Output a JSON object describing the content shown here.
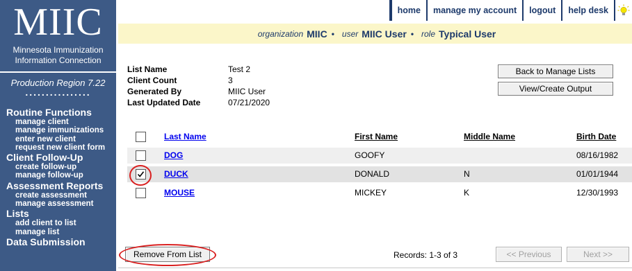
{
  "sidebar": {
    "logo": "MIIC",
    "subtitle_line1": "Minnesota Immunization",
    "subtitle_line2": "Information Connection",
    "region": "Production Region 7.22",
    "dots": "................",
    "sections": [
      {
        "heading": "Routine Functions",
        "items": [
          "manage client",
          "manage immunizations",
          "enter new client",
          "request new client form"
        ]
      },
      {
        "heading": "Client Follow-Up",
        "items": [
          "create follow-up",
          "manage follow-up"
        ]
      },
      {
        "heading": "Assessment Reports",
        "items": [
          "create assessment",
          "manage assessment"
        ]
      },
      {
        "heading": "Lists",
        "items": [
          "add client to list",
          "manage list"
        ]
      },
      {
        "heading": "Data Submission",
        "items": []
      }
    ]
  },
  "topnav": {
    "home": "home",
    "manage_account": "manage my account",
    "logout": "logout",
    "help_desk": "help desk",
    "bulb_icon": "lightbulb-icon"
  },
  "info_bar": {
    "org_label": "organization",
    "org_value": "MIIC",
    "user_label": "user",
    "user_value": "MIIC User",
    "role_label": "role",
    "role_value": "Typical User"
  },
  "summary": {
    "list_name_label": "List Name",
    "list_name_value": "Test 2",
    "client_count_label": "Client Count",
    "client_count_value": "3",
    "generated_by_label": "Generated By",
    "generated_by_value": "MIIC User",
    "last_updated_label": "Last Updated Date",
    "last_updated_value": "07/21/2020"
  },
  "buttons": {
    "back": "Back to Manage Lists",
    "view_output": "View/Create Output",
    "remove": "Remove From List",
    "previous": "<< Previous",
    "next": "Next >>"
  },
  "table": {
    "headers": {
      "last_name": "Last Name",
      "first_name": "First Name",
      "middle_name": "Middle Name",
      "birth_date": "Birth Date"
    },
    "rows": [
      {
        "last_name": "DOG",
        "first_name": "GOOFY",
        "middle_name": "",
        "birth_date": "08/16/1982",
        "checked": false
      },
      {
        "last_name": "DUCK",
        "first_name": "DONALD",
        "middle_name": "N",
        "birth_date": "01/01/1944",
        "checked": true
      },
      {
        "last_name": "MOUSE",
        "first_name": "MICKEY",
        "middle_name": "K",
        "birth_date": "12/30/1993",
        "checked": false
      }
    ]
  },
  "records": "Records: 1-3 of 3",
  "colors": {
    "sidebar": "#3d5a86",
    "navy": "#1d3a6b",
    "info_bar": "#fbf6c9",
    "highlight_ring": "#d92020",
    "link": "#0000ee"
  }
}
